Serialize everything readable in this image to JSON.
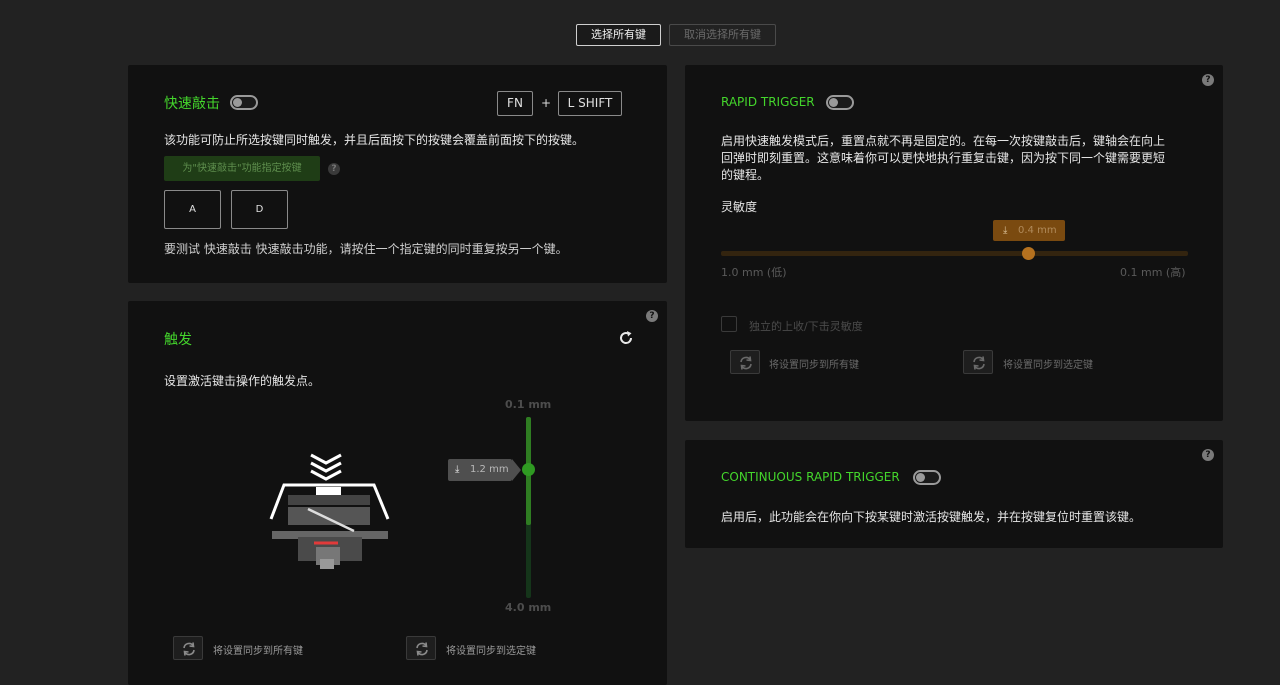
{
  "top_buttons": {
    "select_all": "选择所有键",
    "deselect_all": "取消选择所有键"
  },
  "snap_tap": {
    "title": "快速敲击",
    "enabled": false,
    "shortcut_key_1": "FN",
    "shortcut_plus": "+",
    "shortcut_key_2": "L SHIFT",
    "description": "该功能可防止所选按键同时触发，并且后面按下的按键会覆盖前面按下的按键。",
    "assign_button": "为\"快速敲击\"功能指定按键",
    "key_a": "A",
    "key_d": "D",
    "test_hint": "要测试 快速敲击 快速敲击功能，请按住一个指定键的同时重复按另一个键。"
  },
  "actuation": {
    "title": "触发",
    "description": "设置激活键击操作的触发点。",
    "top_label": "0.1 mm",
    "bottom_label": "4.0 mm",
    "current_value": "1.2 mm",
    "value_mm": 1.2,
    "sync_all": "将设置同步到所有键",
    "sync_selected": "将设置同步到选定键"
  },
  "rapid_trigger": {
    "title": "RAPID TRIGGER",
    "enabled": false,
    "description_line1": "启用快速触发模式后，重置点就不再是固定的。在每一次按键敲击后，键轴会在向上",
    "description_line2": "回弹时即刻重置。这意味着你可以更快地执行重复击键，因为按下同一个键需要更短",
    "description_line3": "的键程。",
    "sensitivity_label": "灵敏度",
    "slider_value": "0.4 mm",
    "slider_fraction": 0.65,
    "min_label": "1.0 mm (低)",
    "max_label": "0.1 mm (高)",
    "separate_checkbox": "独立的上收/下击灵敏度",
    "sync_all": "将设置同步到所有键",
    "sync_selected": "将设置同步到选定键"
  },
  "continuous_rapid_trigger": {
    "title": "CONTINUOUS RAPID TRIGGER",
    "enabled": false,
    "description": "启用后，此功能会在你向下按某键时激活按键触发，并在按键复位时重置该键。"
  },
  "help_glyph": "?",
  "colors": {
    "accent": "#44d62c",
    "orange": "#7a4a10",
    "panel": "#111111",
    "background": "#222222"
  }
}
